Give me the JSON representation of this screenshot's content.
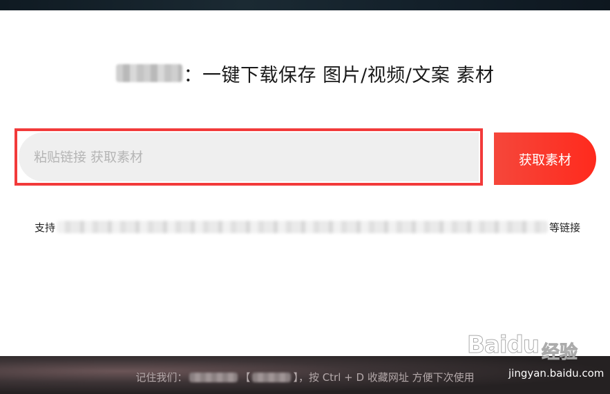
{
  "headline": {
    "text": "：一键下载保存 图片/视频/文案 素材"
  },
  "search": {
    "placeholder": "粘贴链接 获取素材",
    "value": "",
    "button_label": "获取素材"
  },
  "support": {
    "prefix": "支持",
    "suffix": "等链接"
  },
  "footer": {
    "prefix": "记住我们：",
    "middle": "【",
    "suffix": "】，按 Ctrl + D 收藏网址 方便下次使用"
  },
  "watermark": {
    "logo": "Baidu",
    "cn": "经验",
    "url": "jingyan.baidu.com"
  },
  "colors": {
    "accent": "#ff2a1d",
    "highlight_frame": "#f23a3a",
    "input_bg": "#efefef"
  }
}
